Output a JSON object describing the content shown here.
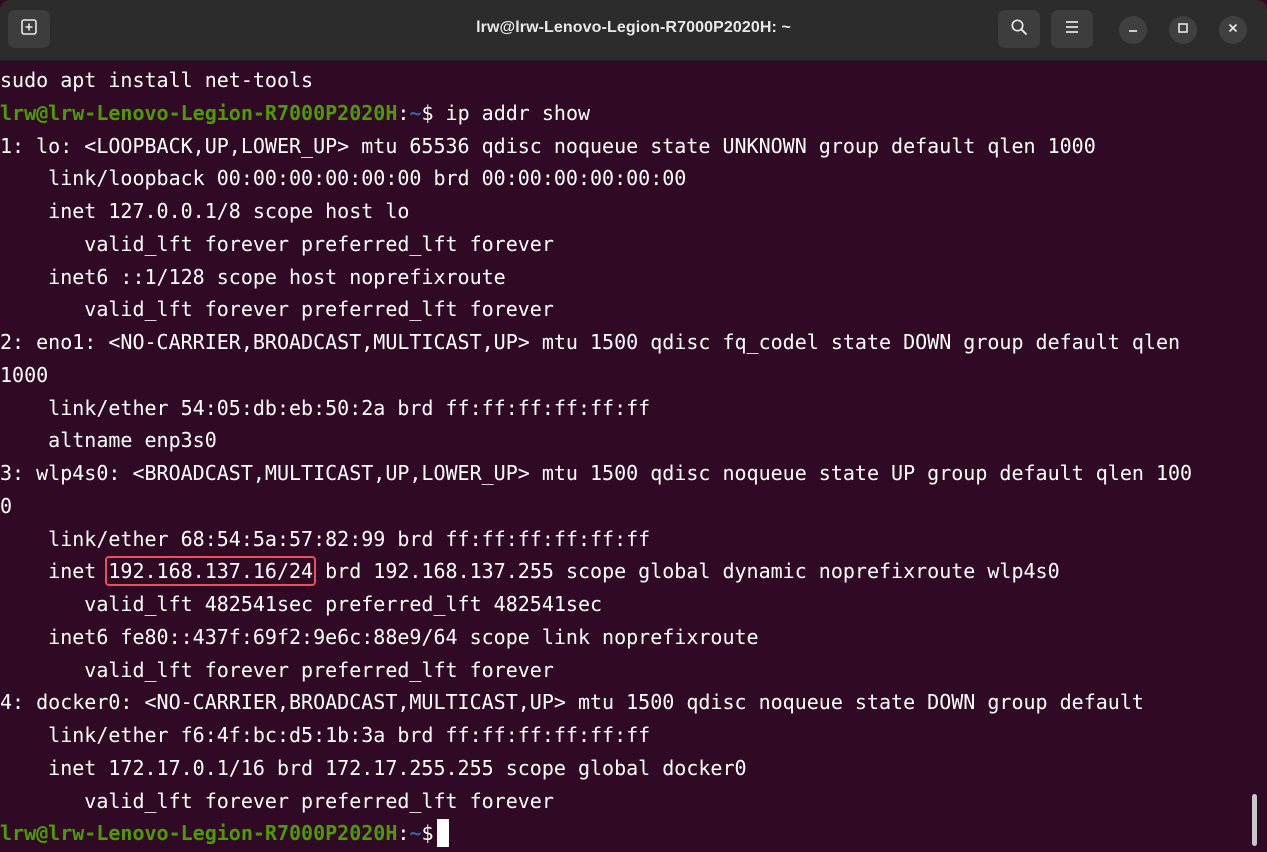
{
  "window": {
    "title": "lrw@lrw-Lenovo-Legion-R7000P2020H: ~",
    "buttons": {
      "new_tab_icon": "new-tab-icon",
      "search_icon": "search-icon",
      "menu_icon": "hamburger-menu-icon",
      "minimize_icon": "minimize-icon",
      "maximize_icon": "maximize-icon",
      "close_icon": "close-icon"
    }
  },
  "colors": {
    "background": "#300a24",
    "titlebar": "#2c2c2c",
    "prompt_user": "#4e9a06",
    "prompt_path": "#3465a4",
    "highlight_box": "#e8525c",
    "text": "#ffffff"
  },
  "terminal": {
    "lines": {
      "l0": "sudo apt install net-tools",
      "l1_user": "lrw@lrw-Lenovo-Legion-R7000P2020H",
      "l1_colon": ":",
      "l1_path": "~",
      "l1_cmd": "$ ip addr show",
      "l2": "1: lo: <LOOPBACK,UP,LOWER_UP> mtu 65536 qdisc noqueue state UNKNOWN group default qlen 1000",
      "l3": "    link/loopback 00:00:00:00:00:00 brd 00:00:00:00:00:00",
      "l4": "    inet 127.0.0.1/8 scope host lo",
      "l5": "       valid_lft forever preferred_lft forever",
      "l6": "    inet6 ::1/128 scope host noprefixroute",
      "l7": "       valid_lft forever preferred_lft forever",
      "l8": "2: eno1: <NO-CARRIER,BROADCAST,MULTICAST,UP> mtu 1500 qdisc fq_codel state DOWN group default qlen",
      "l9": "1000",
      "l10": "    link/ether 54:05:db:eb:50:2a brd ff:ff:ff:ff:ff:ff",
      "l11": "    altname enp3s0",
      "l12": "3: wlp4s0: <BROADCAST,MULTICAST,UP,LOWER_UP> mtu 1500 qdisc noqueue state UP group default qlen 100",
      "l13": "0",
      "l14": "    link/ether 68:54:5a:57:82:99 brd ff:ff:ff:ff:ff:ff",
      "l15_pre": "    inet ",
      "l15_ip": "192.168.137.16/24",
      "l15_post": " brd 192.168.137.255 scope global dynamic noprefixroute wlp4s0",
      "l16": "       valid_lft 482541sec preferred_lft 482541sec",
      "l17": "    inet6 fe80::437f:69f2:9e6c:88e9/64 scope link noprefixroute",
      "l18": "       valid_lft forever preferred_lft forever",
      "l19": "4: docker0: <NO-CARRIER,BROADCAST,MULTICAST,UP> mtu 1500 qdisc noqueue state DOWN group default",
      "l20": "    link/ether f6:4f:bc:d5:1b:3a brd ff:ff:ff:ff:ff:ff",
      "l21": "    inet 172.17.0.1/16 brd 172.17.255.255 scope global docker0",
      "l22": "       valid_lft forever preferred_lft forever",
      "l23_user": "lrw@lrw-Lenovo-Legion-R7000P2020H",
      "l23_colon": ":",
      "l23_path": "~",
      "l23_cmd": "$"
    }
  }
}
